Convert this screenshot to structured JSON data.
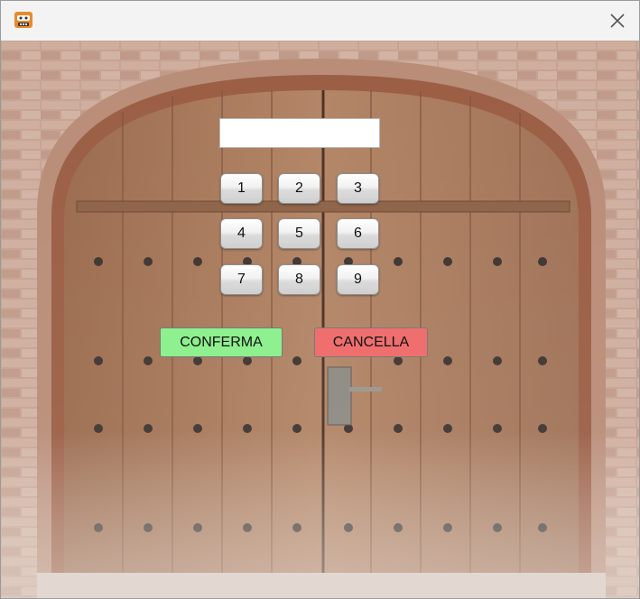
{
  "window": {
    "title": ""
  },
  "keypad": {
    "display_value": "",
    "keys": [
      "1",
      "2",
      "3",
      "4",
      "5",
      "6",
      "7",
      "8",
      "9"
    ]
  },
  "actions": {
    "confirm_label": "CONFERMA",
    "cancel_label": "CANCELLA"
  },
  "colors": {
    "confirm": "#8ef08e",
    "cancel": "#ef6f6f",
    "wood": "#a9795a",
    "brick": "#c4a18f"
  },
  "icons": {
    "app": "game-controller-icon",
    "close": "close-icon"
  }
}
